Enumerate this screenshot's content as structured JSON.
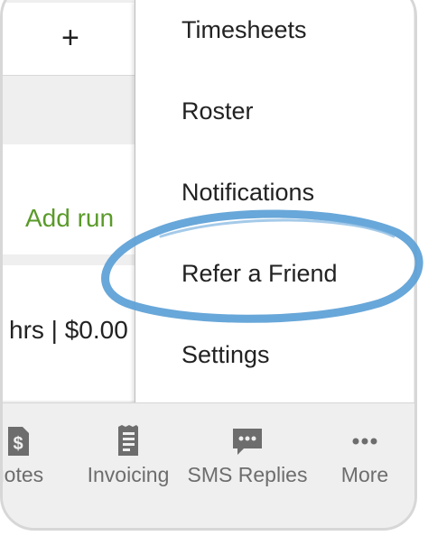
{
  "toolbar": {
    "add_icon": "plus-icon",
    "add_label": "+"
  },
  "jobs": {
    "add_run_label": "Add run",
    "summary": "hrs | $0.00"
  },
  "menu": {
    "items": [
      {
        "label": "Timesheets"
      },
      {
        "label": "Roster"
      },
      {
        "label": "Notifications"
      },
      {
        "label": "Refer a Friend",
        "highlighted": true
      },
      {
        "label": "Settings"
      }
    ]
  },
  "tabbar": {
    "tabs": [
      {
        "label": "uotes",
        "icon": "dollar-document-icon"
      },
      {
        "label": "Invoicing",
        "icon": "receipt-icon"
      },
      {
        "label": "SMS Replies",
        "icon": "chat-bubble-icon"
      },
      {
        "label": "More",
        "icon": "ellipsis-icon"
      }
    ]
  },
  "colors": {
    "accent_green": "#5a9a2a",
    "highlight_circle": "#5b9fd6",
    "tab_gray": "#6d6d6d"
  }
}
